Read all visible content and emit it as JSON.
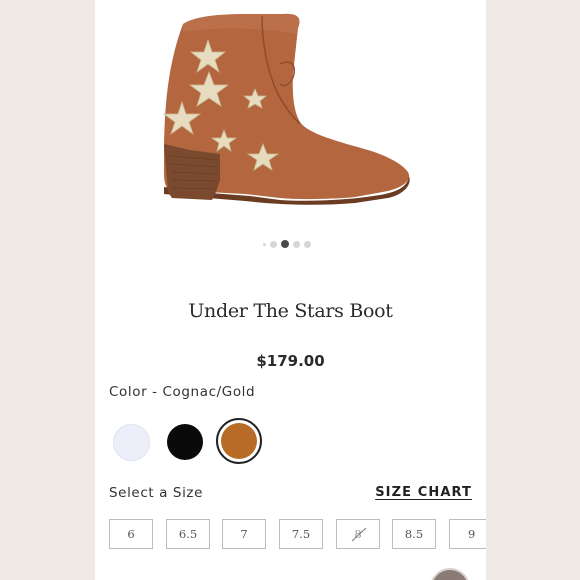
{
  "product": {
    "image_alt": "Cognac suede western ankle boot with gold star appliqués",
    "carousel": {
      "count": 5,
      "active_index": 2
    },
    "title": "Under The Stars Boot",
    "price": "$179.00"
  },
  "color": {
    "label": "Color - Cognac/Gold",
    "options": [
      {
        "name": "White",
        "hex": "#eceefa",
        "selected": false
      },
      {
        "name": "Black",
        "hex": "#0a0a0a",
        "selected": false
      },
      {
        "name": "Cognac/Gold",
        "hex": "#b86b26",
        "selected": true
      }
    ]
  },
  "size": {
    "label": "Select a Size",
    "chart_link": "SIZE CHART",
    "options": [
      {
        "label": "6",
        "available": true
      },
      {
        "label": "6.5",
        "available": true
      },
      {
        "label": "7",
        "available": true
      },
      {
        "label": "7.5",
        "available": true
      },
      {
        "label": "8",
        "available": false
      },
      {
        "label": "8.5",
        "available": true
      },
      {
        "label": "9",
        "available": true
      }
    ]
  },
  "colors": {
    "boot_leather": "#b4673f",
    "heel": "#7b4a2e",
    "star_gold": "#e8dcc0"
  }
}
